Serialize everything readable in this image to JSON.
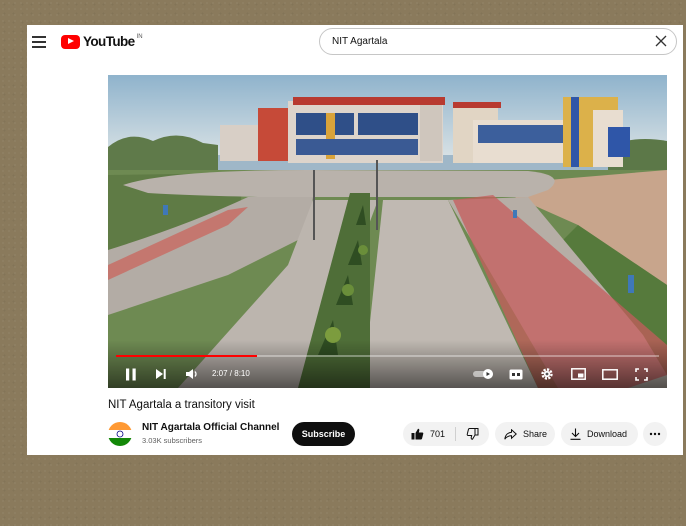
{
  "header": {
    "logo_text": "YouTube",
    "logo_country": "IN",
    "search_value": "NIT Agartala"
  },
  "player": {
    "time": "2:07 / 8:10",
    "progress": 0.26
  },
  "video": {
    "title": "NIT Agartala a transitory visit"
  },
  "channel": {
    "name": "NIT Agartala Official Channel",
    "subscribers": "3.03K subscribers",
    "subscribe_label": "Subscribe"
  },
  "actions": {
    "like_count": "701",
    "share_label": "Share",
    "download_label": "Download"
  },
  "colors": {
    "brand": "#ff0000",
    "subscribe_bg": "#0f0f0f",
    "background": "#8a7a5c"
  }
}
